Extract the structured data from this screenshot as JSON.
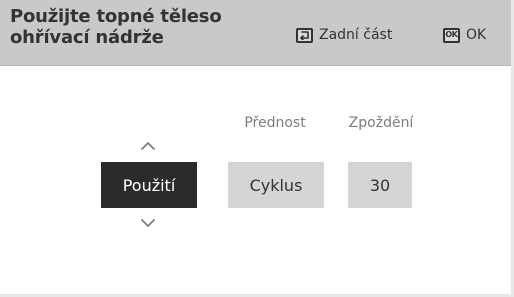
{
  "header": {
    "title": "Použijte topné těleso\nohřívací nádrže",
    "back_label": "Zadní část",
    "ok_icon_text": "OK",
    "ok_label": "OK",
    "back_icon": "back-arrow-icon"
  },
  "settings": {
    "preference_label": "Přednost",
    "delay_label": "Zpoždění",
    "use_value": "Použití",
    "cycle_value": "Cyklus",
    "delay_value": "30"
  },
  "colors": {
    "header_bg": "#c9c9c9",
    "selected_bg": "#2b2b2b",
    "option_bg": "#d5d5d5",
    "text": "#333333",
    "muted_text": "#7d7d7d"
  },
  "icons": [
    "back-arrow-icon",
    "ok-icon",
    "chevron-up-icon",
    "chevron-down-icon"
  ]
}
